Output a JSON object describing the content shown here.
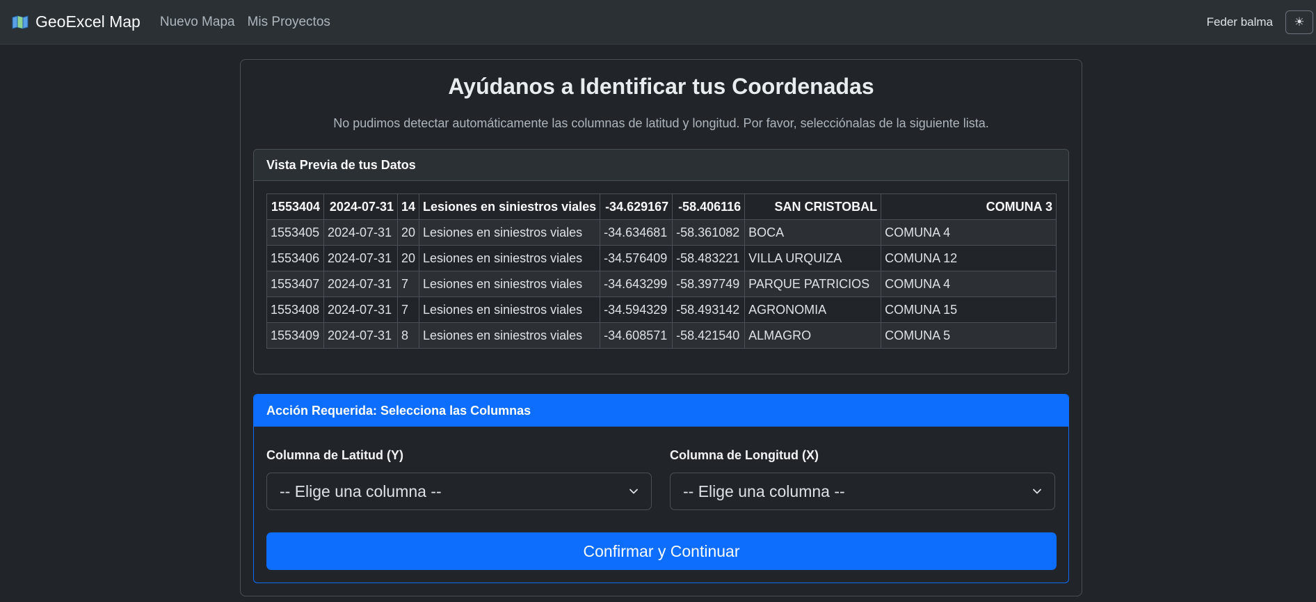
{
  "navbar": {
    "brand": "GeoExcel Map",
    "links": [
      "Nuevo Mapa",
      "Mis Proyectos"
    ],
    "user_name": "Feder balma",
    "theme_icon": "☀"
  },
  "page": {
    "title": "Ayúdanos a Identificar tus Coordenadas",
    "subtitle": "No pudimos detectar automáticamente las columnas de latitud y longitud. Por favor, selecciónalas de la siguiente lista."
  },
  "preview": {
    "header": "Vista Previa de tus Datos",
    "columns": [
      "1553404",
      "2024-07-31",
      "14",
      "Lesiones en siniestros viales",
      "-34.629167",
      "-58.406116",
      "SAN CRISTOBAL",
      "COMUNA 3"
    ],
    "rows": [
      [
        "1553405",
        "2024-07-31",
        "20",
        "Lesiones en siniestros viales",
        "-34.634681",
        "-58.361082",
        "BOCA",
        "COMUNA 4"
      ],
      [
        "1553406",
        "2024-07-31",
        "20",
        "Lesiones en siniestros viales",
        "-34.576409",
        "-58.483221",
        "VILLA URQUIZA",
        "COMUNA 12"
      ],
      [
        "1553407",
        "2024-07-31",
        "7",
        "Lesiones en siniestros viales",
        "-34.643299",
        "-58.397749",
        "PARQUE PATRICIOS",
        "COMUNA 4"
      ],
      [
        "1553408",
        "2024-07-31",
        "7",
        "Lesiones en siniestros viales",
        "-34.594329",
        "-58.493142",
        "AGRONOMIA",
        "COMUNA 15"
      ],
      [
        "1553409",
        "2024-07-31",
        "8",
        "Lesiones en siniestros viales",
        "-34.608571",
        "-58.421540",
        "ALMAGRO",
        "COMUNA 5"
      ]
    ]
  },
  "action": {
    "header": "Acción Requerida: Selecciona las Columnas",
    "lat_label": "Columna de Latitud (Y)",
    "lat_selected": "-- Elige una columna --",
    "lon_label": "Columna de Longitud (X)",
    "lon_selected": "-- Elige una columna --",
    "confirm_label": "Confirmar y Continuar"
  },
  "colors": {
    "accent": "#0d6efd",
    "background": "#212529",
    "navbar": "#2b3035"
  }
}
